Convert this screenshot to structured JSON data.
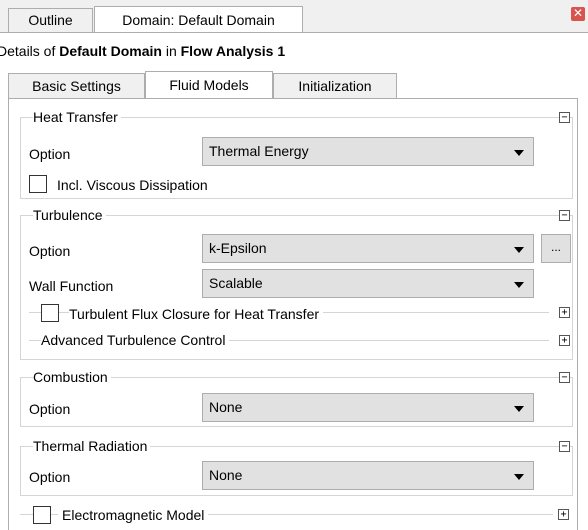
{
  "tabs": {
    "outline": "Outline",
    "domain": "Domain: Default Domain"
  },
  "close_glyph": "✕",
  "details": {
    "prefix": "Details of ",
    "object": "Default Domain",
    "middle": " in ",
    "analysis": "Flow Analysis 1"
  },
  "subtabs": [
    "Basic Settings",
    "Fluid Models",
    "Initialization"
  ],
  "active_subtab": "Fluid Models",
  "heat_transfer": {
    "title": "Heat Transfer",
    "option_label": "Option",
    "option_value": "Thermal Energy",
    "viscous_label": "Incl. Viscous Dissipation",
    "viscous_checked": false
  },
  "turbulence": {
    "title": "Turbulence",
    "option_label": "Option",
    "option_value": "k-Epsilon",
    "dots": "...",
    "wall_label": "Wall Function",
    "wall_value": "Scalable",
    "flux_label": "Turbulent Flux Closure for Heat Transfer",
    "flux_checked": false,
    "advanced_label": "Advanced Turbulence Control"
  },
  "combustion": {
    "title": "Combustion",
    "option_label": "Option",
    "option_value": "None"
  },
  "thermal_radiation": {
    "title": "Thermal Radiation",
    "option_label": "Option",
    "option_value": "None"
  },
  "electromagnetic": {
    "label": "Electromagnetic Model",
    "checked": false
  },
  "icons": {
    "collapse": "−",
    "expand": "+"
  },
  "colors": {
    "close_red": "#d9534f",
    "panel_bg": "#ffffff",
    "chrome_bg": "#f0f0f0",
    "select_bg": "#e1e1e1"
  }
}
